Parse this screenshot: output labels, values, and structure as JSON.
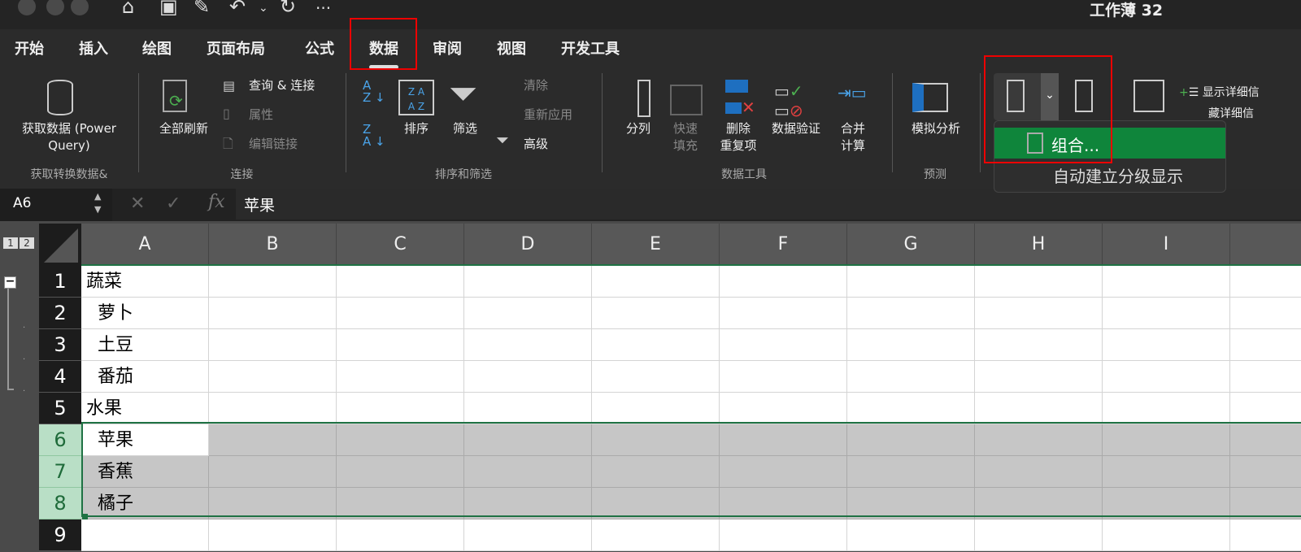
{
  "window": {
    "title": "工作薄 32",
    "quick_access": [
      "home-icon",
      "save-icon",
      "edit-save-icon",
      "undo-icon",
      "redo-icon",
      "more-icon"
    ],
    "more": "···"
  },
  "tabs": [
    {
      "label": "开始"
    },
    {
      "label": "插入"
    },
    {
      "label": "绘图"
    },
    {
      "label": "页面布局"
    },
    {
      "label": "公式"
    },
    {
      "label": "数据",
      "active": true
    },
    {
      "label": "审阅"
    },
    {
      "label": "视图"
    },
    {
      "label": "开发工具"
    }
  ],
  "ribbon": {
    "get_data": {
      "label": "获取数据 (Power Query)",
      "group": "获取转换数据&"
    },
    "connections": {
      "refresh_all": "全部刷新",
      "queries": "查询 & 连接",
      "properties": "属性",
      "edit_links": "编辑链接",
      "group": "连接"
    },
    "sort_filter": {
      "sort_az": "A→Z",
      "sort_za": "Z→A",
      "sort": "排序",
      "filter": "筛选",
      "clear": "清除",
      "reapply": "重新应用",
      "advanced": "高级",
      "group": "排序和筛选"
    },
    "data_tools": {
      "text_to_columns": "分列",
      "flash_fill": "快速\n填充",
      "flash_fill_1": "快速",
      "flash_fill_2": "填充",
      "remove_dup_1": "删除",
      "remove_dup_2": "重复项",
      "validation": "数据验证",
      "consolidate_1": "合并",
      "consolidate_2": "计算",
      "group": "数据工具"
    },
    "forecast": {
      "what_if": "模拟分析",
      "group": "预测"
    },
    "outline": {
      "show_detail": "显示详细信",
      "hide_detail": "藏详细信"
    }
  },
  "dropdown": {
    "items": [
      {
        "label": "组合...",
        "highlighted": true
      },
      {
        "label": "自动建立分级显示"
      }
    ],
    "highlight_color": "#0f853b"
  },
  "formula_bar": {
    "name_box": "A6",
    "content": "苹果",
    "fx": "fx"
  },
  "outline_levels": [
    "1",
    "2"
  ],
  "columns": [
    "A",
    "B",
    "C",
    "D",
    "E",
    "F",
    "G",
    "H",
    "I"
  ],
  "rows": [
    {
      "n": "1",
      "a": "蔬菜"
    },
    {
      "n": "2",
      "a": "  萝卜"
    },
    {
      "n": "3",
      "a": "  土豆"
    },
    {
      "n": "4",
      "a": "  番茄"
    },
    {
      "n": "5",
      "a": "水果"
    },
    {
      "n": "6",
      "a": "  苹果"
    },
    {
      "n": "7",
      "a": "  香蕉"
    },
    {
      "n": "8",
      "a": "  橘子"
    },
    {
      "n": "9",
      "a": ""
    }
  ],
  "accent": "#1f7244"
}
